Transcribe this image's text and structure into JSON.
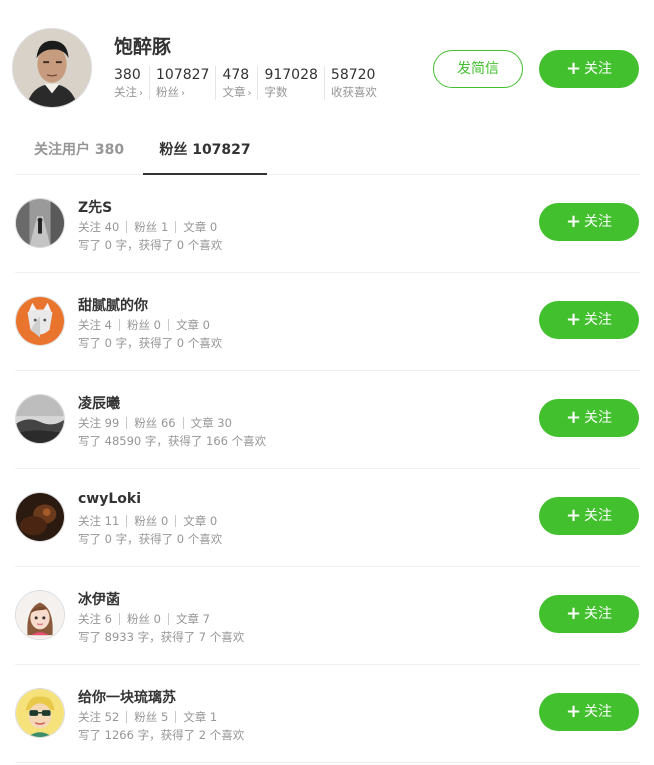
{
  "profile": {
    "name": "饱醉豚",
    "stats": [
      {
        "value": "380",
        "label": "关注",
        "arrow": "›"
      },
      {
        "value": "107827",
        "label": "粉丝",
        "arrow": "›"
      },
      {
        "value": "478",
        "label": "文章",
        "arrow": "›"
      },
      {
        "value": "917028",
        "label": "字数",
        "arrow": ""
      },
      {
        "value": "58720",
        "label": "收获喜欢",
        "arrow": ""
      }
    ],
    "message_button": "发简信",
    "follow_button": "关注",
    "plus_glyph": "+"
  },
  "tabs": {
    "following": "关注用户 380",
    "fans": "粉丝 107827"
  },
  "users": [
    {
      "name": "Z先S",
      "following": "关注 40",
      "fans": "粉丝 1",
      "articles": "文章 0",
      "desc": "写了 0 字，获得了 0 个喜欢",
      "button": "关注",
      "avatar": "street-photo"
    },
    {
      "name": "甜腻腻的你",
      "following": "关注 4",
      "fans": "粉丝 0",
      "articles": "文章 0",
      "desc": "写了 0 字，获得了 0 个喜欢",
      "button": "关注",
      "avatar": "cat-illustration"
    },
    {
      "name": "凌辰曦",
      "following": "关注 99",
      "fans": "粉丝 66",
      "articles": "文章 30",
      "desc": "写了 48590 字，获得了 166 个喜欢",
      "button": "关注",
      "avatar": "misty-landscape"
    },
    {
      "name": "cwyLoki",
      "following": "关注 11",
      "fans": "粉丝 0",
      "articles": "文章 0",
      "desc": "写了 0 字，获得了 0 个喜欢",
      "button": "关注",
      "avatar": "dark-portrait"
    },
    {
      "name": "冰伊菡",
      "following": "关注 6",
      "fans": "粉丝 0",
      "articles": "文章 7",
      "desc": "写了 8933 字，获得了 7 个喜欢",
      "button": "关注",
      "avatar": "cartoon-girl"
    },
    {
      "name": "给你一块琉璃苏",
      "following": "关注 52",
      "fans": "粉丝 5",
      "articles": "文章 1",
      "desc": "写了 1266 字，获得了 2 个喜欢",
      "button": "关注",
      "avatar": "cartoon-sunglasses"
    }
  ],
  "colors": {
    "accent": "#42c02e",
    "muted": "#969696",
    "text": "#333333",
    "divider": "#f0f0f0"
  }
}
